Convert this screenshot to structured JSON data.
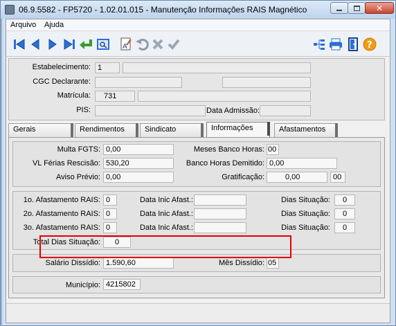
{
  "window": {
    "title": "06.9.5582 - FP5720 - 1.02.01.015 - Manutenção Informações RAIS Magnético"
  },
  "menu": {
    "items": [
      "Arquivo",
      "Ajuda"
    ]
  },
  "toolbar": {
    "icons": [
      "first-icon",
      "previous-icon",
      "next-icon",
      "last-icon",
      "return-icon",
      "view-icon",
      "edit-icon",
      "undo-icon",
      "cancel-icon",
      "confirm-icon",
      "tree-icon",
      "print-icon",
      "exit-door-icon",
      "help-icon"
    ]
  },
  "header": {
    "estabelecimento_label": "Estabelecimento:",
    "estabelecimento_value": "1",
    "cgc_label": "CGC Declarante:",
    "cgc_value": "",
    "matricula_label": "Matrícula:",
    "matricula_value": "731",
    "pis_label": "PIS:",
    "pis_value": "",
    "data_admissao_label": "Data Admissão:",
    "data_admissao_value": ""
  },
  "tabs": [
    {
      "label": "Gerais"
    },
    {
      "label": "Rendimentos"
    },
    {
      "label": "Sindicato"
    },
    {
      "label": "Informações"
    },
    {
      "label": "Afastamentos"
    }
  ],
  "info": {
    "multa_fgts_label": "Multa FGTS:",
    "multa_fgts_value": "0,00",
    "meses_banco_horas_label": "Meses Banco Horas:",
    "meses_banco_horas_value": "00",
    "vl_ferias_label": "VL Férias Rescisão:",
    "vl_ferias_value": "530,20",
    "banco_horas_demitido_label": "Banco Horas Demitido:",
    "banco_horas_demitido_value": "0,00",
    "aviso_previo_label": "Aviso Prévio:",
    "aviso_previo_value": "0,00",
    "gratificacao_label": "Gratificação:",
    "gratificacao_value": "0,00",
    "gratificacao_months": "00"
  },
  "afastamentos": {
    "rows": [
      {
        "label": "1o. Afastamento RAIS:",
        "value": "0",
        "data_label": "Data Inic Afast.:",
        "data_value": "",
        "dias_label": "Dias Situação:",
        "dias_value": "0"
      },
      {
        "label": "2o. Afastamento RAIS:",
        "value": "0",
        "data_label": "Data Inic Afast.:",
        "data_value": "",
        "dias_label": "Dias Situação:",
        "dias_value": "0"
      },
      {
        "label": "3o. Afastamento RAIS:",
        "value": "0",
        "data_label": "Data Inic Afast.:",
        "data_value": "",
        "dias_label": "Dias Situação:",
        "dias_value": "0"
      }
    ],
    "total_label": "Total Dias Situação:",
    "total_value": "0"
  },
  "dissidio": {
    "salario_label": "Salário Dissídio:",
    "salario_value": "1.590,60",
    "mes_label": "Mês Dissídio:",
    "mes_value": "05"
  },
  "municipio": {
    "label": "Município:",
    "value": "4215802"
  },
  "colors": {
    "highlight": "#e00000",
    "toolbar_blue": "#2a6fd6",
    "toolbar_green": "#3c9a2e",
    "help_orange": "#f39c12"
  }
}
